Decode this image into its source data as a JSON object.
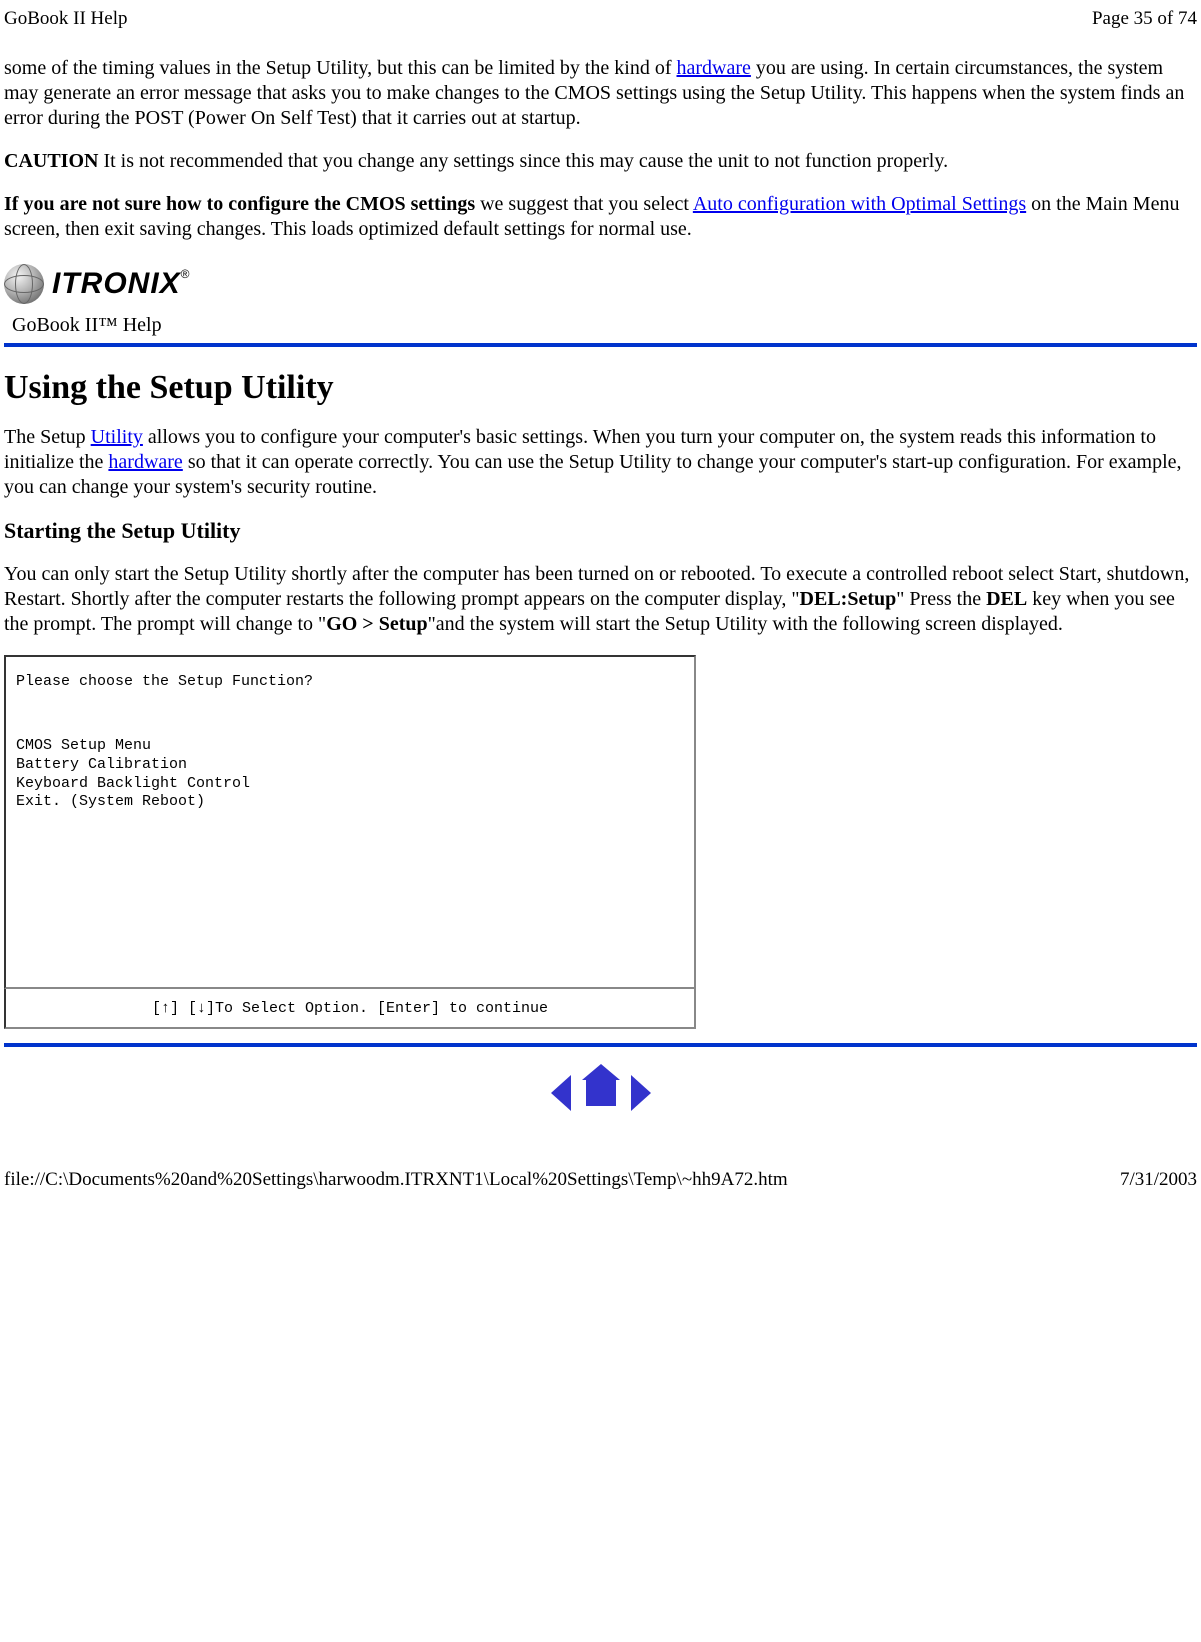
{
  "header": {
    "title": "GoBook II Help",
    "page_indicator": "Page 35 of 74"
  },
  "body": {
    "para1_pre": "some of the timing values in the Setup Utility, but this can be limited by the kind of ",
    "para1_link": "hardware",
    "para1_post": " you are using. In certain circumstances, the system may generate an error message that asks you to make changes to the CMOS settings using the Setup Utility. This happens when the system finds an error during the POST (Power On Self Test) that it carries out at startup.",
    "caution_label": "CAUTION",
    "caution_text": "  It is not recommended that you change any settings since this may cause the unit to not function properly.",
    "para2_bold": "If you are not sure how to configure the CMOS settings",
    "para2_mid": " we suggest that you select ",
    "para2_link": "Auto configuration with Optimal Settings",
    "para2_post": " on the Main Menu screen, then exit saving changes.  This loads optimized default settings for normal use."
  },
  "logo": {
    "brand": "ITRONIX",
    "reg": "®",
    "subtitle": "GoBook II™ Help"
  },
  "section": {
    "title": "Using the Setup Utility",
    "intro_pre": "The Setup ",
    "intro_link1": "Utility",
    "intro_mid1": " allows you to configure your computer's basic settings. When you turn your computer on, the system reads this information to initialize the ",
    "intro_link2": "hardware",
    "intro_mid2": " so that it can operate correctly. You can use the Setup Utility to change your computer's start-up configuration. For example, you can change your system's security routine.",
    "sub_title": "Starting the Setup Utility",
    "start_p1": "You can only start the Setup Utility shortly after the computer has been turned on or rebooted. To execute a controlled reboot select Start, shutdown, Restart.  Shortly after the computer restarts the following prompt appears on the computer display, \"",
    "start_b1": "DEL:Setup",
    "start_p2": "\"  Press the ",
    "start_b2": "DEL",
    "start_p3": " key when you see the  prompt.  The prompt will change to \"",
    "start_b3": "GO > Setup",
    "start_p4": "\"and the system will start the Setup Utility with the following screen displayed."
  },
  "screenshot": {
    "prompt": "Please choose the Setup Function?",
    "menu": [
      "CMOS Setup Menu",
      "Battery Calibration",
      "Keyboard Backlight Control",
      "Exit. (System Reboot)"
    ],
    "footer": "[↑] [↓]To Select Option.  [Enter] to continue"
  },
  "footer": {
    "path": "file://C:\\Documents%20and%20Settings\\harwoodm.ITRXNT1\\Local%20Settings\\Temp\\~hh9A72.htm",
    "date": "7/31/2003"
  }
}
